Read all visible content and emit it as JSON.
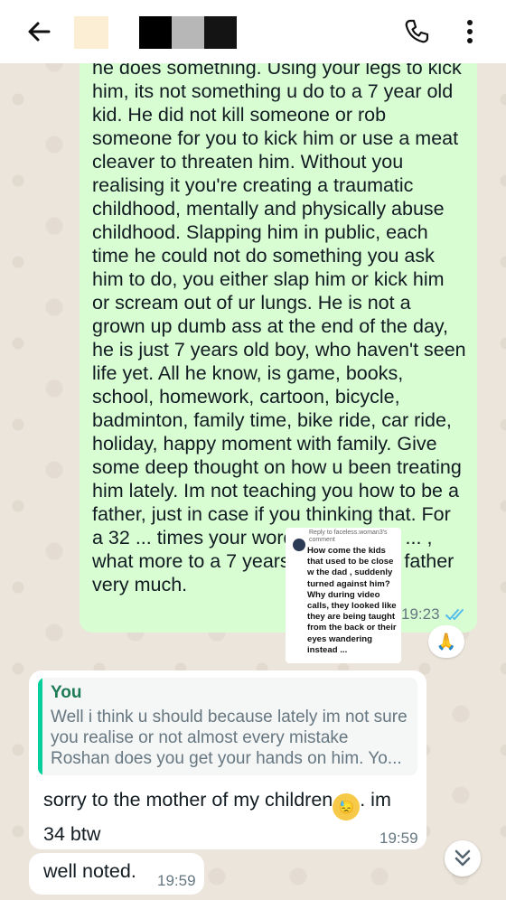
{
  "header": {
    "back_icon": "arrow-left-icon",
    "call_icon": "phone-icon",
    "menu_icon": "more-vert-icon",
    "redact_colors": [
      "#fbeed4",
      "#000000",
      "#b7b7b7",
      "#141414"
    ]
  },
  "messages": {
    "outgoing": {
      "text": "he does something. Using your legs to kick him, its not something u do to a 7 year old kid. He did not kill someone or rob someone for you to kick him or use a meat cleaver to threaten him. Without you realising it you're creating a traumatic childhood, mentally and physically abuse childhood. Slapping him in public, each time he could not do something you ask him to do, you either slap him or kick him or scream out of ur lungs. He is not a grown up dumb ass at the end of the day, he is just 7 years old boy, who haven't seen life yet. All he know, is game, books, school, homework, cartoon, bicycle, badminton, family time, bike ride, car ride, holiday, happy moment with family. Give some deep thought on how u been treating him lately. Im not teaching you how to be a father, just in case if you thinking that. For a 32 ... times your words can be too ... , what more to a 7 years old ... se his father very much.",
      "time": "19:23",
      "reaction": "🙏",
      "bubble_color": "#d9fdd3"
    },
    "incoming_1": {
      "quote_author": "You",
      "quote_text": "Well i think u should because lately im not sure you realise or not almost every mistake Roshan does you get your hands on him. Yo...",
      "text": "sorry to the mother of my children",
      "emoji": "😓",
      "text_after": ". im 34 btw",
      "time": "19:59"
    },
    "incoming_2": {
      "text": "well noted.",
      "time": "19:59"
    }
  },
  "overlay_comment": {
    "reply_label": "Reply to faceless.woman3's comment",
    "text": "How come the kids that used to be close w the dad , suddenly turned against him? Why during video calls, they looked like they are being taught from the back or their eyes wandering instead ..."
  },
  "scroll_down_icon": "double-chevron-down-icon",
  "colors": {
    "tick_blue": "#53bdeb",
    "quote_accent": "#06cf9c"
  }
}
